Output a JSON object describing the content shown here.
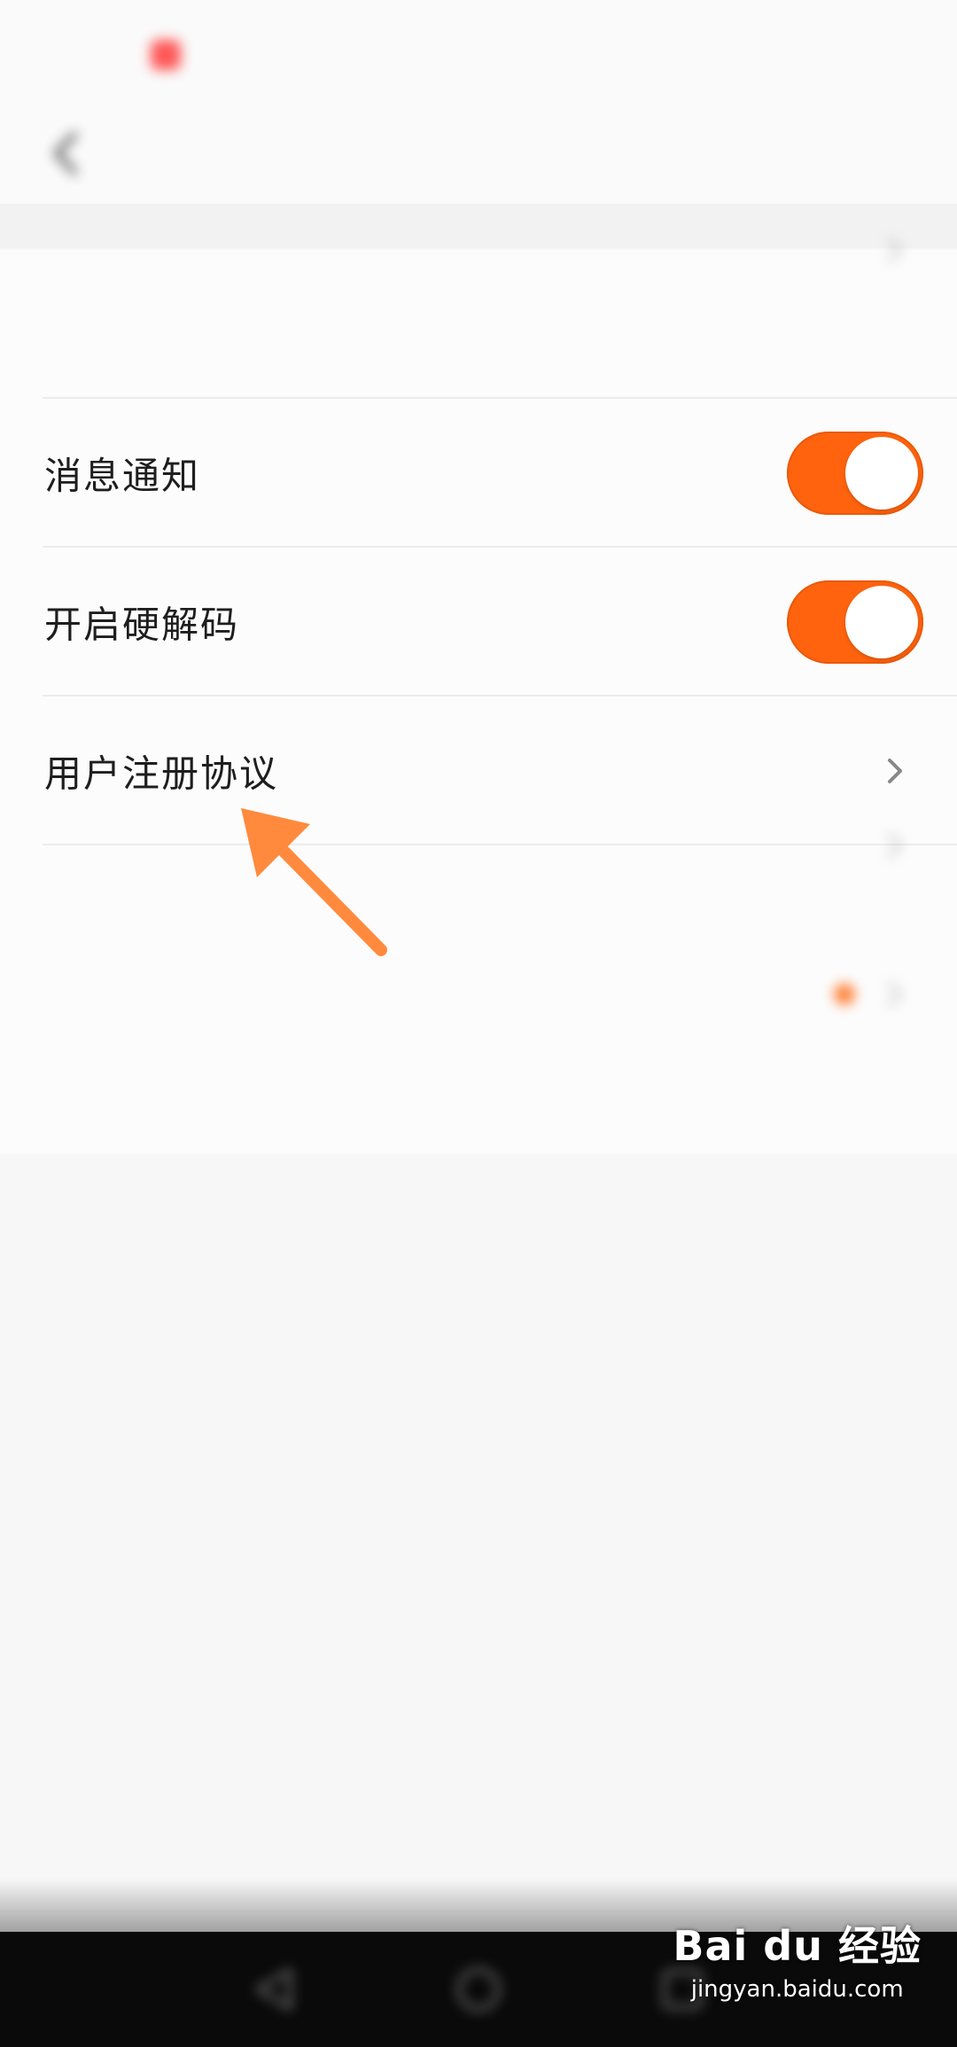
{
  "colors": {
    "accent": "#ff630d",
    "arrow": "#ff8a3d",
    "background": "#f7f7f7",
    "nav_bar": "#0a0a0a"
  },
  "status_bar": {
    "left_text": "",
    "right_text": ""
  },
  "header": {
    "title": "",
    "back_icon": "chevron-left-icon"
  },
  "settings": {
    "row_0": {
      "label": "",
      "value": ""
    },
    "row_1": {
      "label": "消息通知",
      "toggle_on": true
    },
    "row_2": {
      "label": "开启硬解码",
      "toggle_on": true
    },
    "row_3": {
      "label": "用户注册协议",
      "icon": "chevron-right-icon"
    },
    "row_4": {
      "label": "",
      "icon": "chevron-right-icon"
    },
    "row_5": {
      "label": "",
      "icon": "chevron-right-icon",
      "badge": "orange-dot"
    }
  },
  "annotation": {
    "icon": "arrow-up-left-icon"
  },
  "nav_bar": {
    "icons": [
      "back-triangle-icon",
      "home-circle-icon",
      "recents-square-icon"
    ]
  },
  "watermark": {
    "logo": "Bai du 经验",
    "url": "jingyan.baidu.com"
  }
}
